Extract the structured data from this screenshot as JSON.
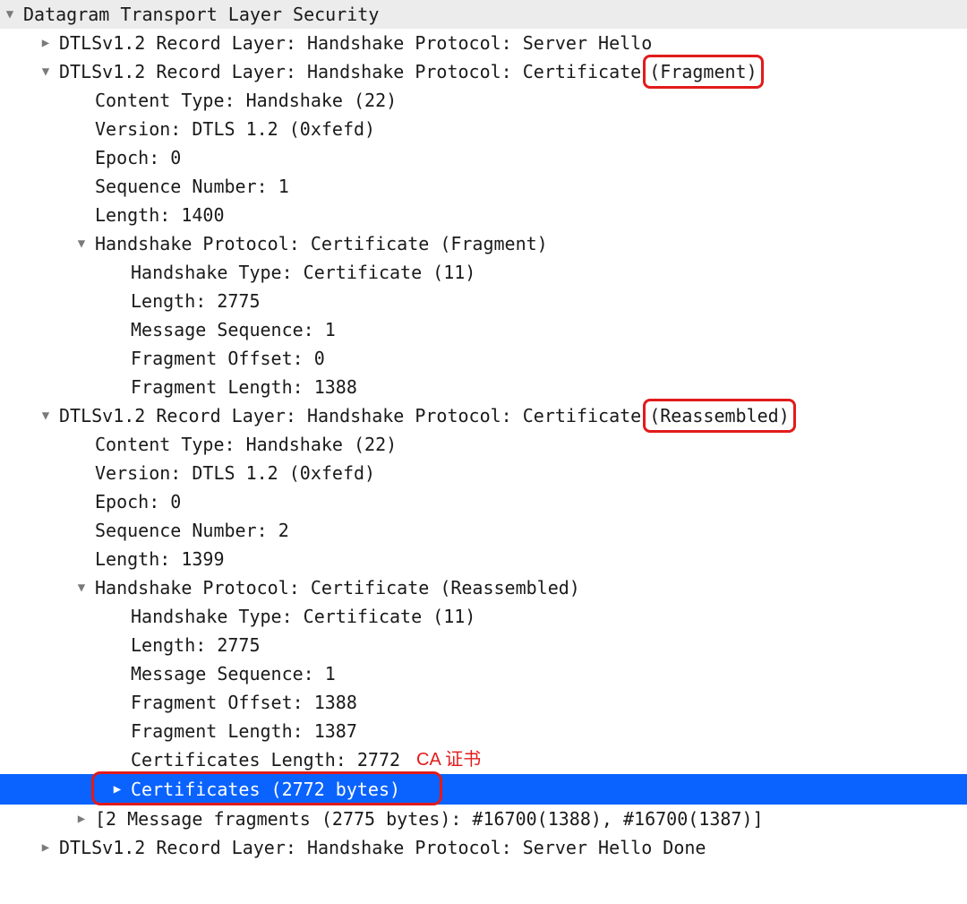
{
  "header": "Datagram Transport Layer Security",
  "record1": "DTLSv1.2 Record Layer: Handshake Protocol: Server Hello",
  "record2": {
    "prefix": "DTLSv1.2 Record Layer: Handshake Protocol: Certificate",
    "badge": "(Fragment)",
    "content_type": "Content Type: Handshake (22)",
    "version": "Version: DTLS 1.2 (0xfefd)",
    "epoch": "Epoch: 0",
    "sequence": "Sequence Number: 1",
    "length": "Length: 1400",
    "hs": {
      "title": "Handshake Protocol: Certificate (Fragment)",
      "type": "Handshake Type: Certificate (11)",
      "length": "Length: 2775",
      "mseq": "Message Sequence: 1",
      "foff": "Fragment Offset: 0",
      "flen": "Fragment Length: 1388"
    }
  },
  "record3": {
    "prefix": "DTLSv1.2 Record Layer: Handshake Protocol: Certificate",
    "badge": "(Reassembled)",
    "content_type": "Content Type: Handshake (22)",
    "version": "Version: DTLS 1.2 (0xfefd)",
    "epoch": "Epoch: 0",
    "sequence": "Sequence Number: 2",
    "length": "Length: 1399",
    "hs": {
      "title": "Handshake Protocol: Certificate (Reassembled)",
      "type": "Handshake Type: Certificate (11)",
      "length": "Length: 2775",
      "mseq": "Message Sequence: 1",
      "foff": "Fragment Offset: 1388",
      "flen": "Fragment Length: 1387",
      "certlen": "Certificates Length: 2772",
      "annot": "CA 证书",
      "certs": "Certificates (2772 bytes)"
    },
    "frags": "[2 Message fragments (2775 bytes): #16700(1388), #16700(1387)]"
  },
  "record4": "DTLSv1.2 Record Layer: Handshake Protocol: Server Hello Done"
}
